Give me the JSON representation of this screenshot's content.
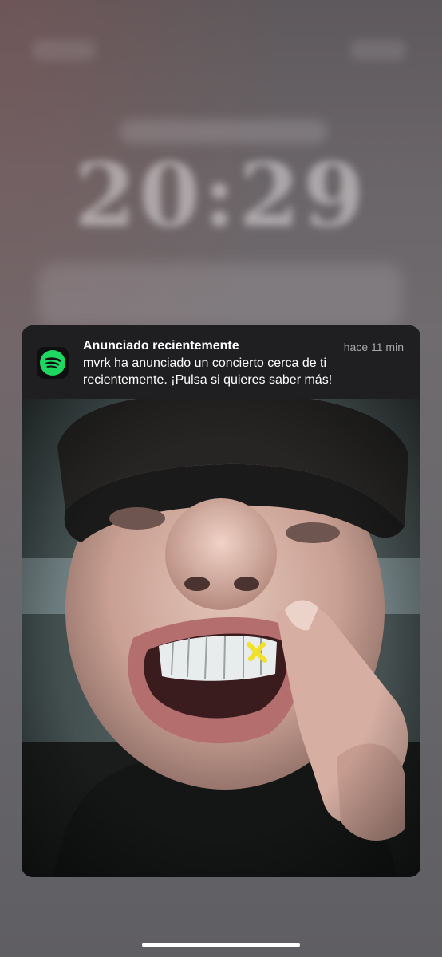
{
  "lock_screen": {
    "clock": "20:29"
  },
  "notification": {
    "app_icon": "spotify-icon",
    "title": "Anunciado recientemente",
    "time": "hace 11 min",
    "body": "mvrk ha anunciado un concierto cerca de ti recientemente. ¡Pulsa si quieres saber más!",
    "image": "artist-photo"
  },
  "colors": {
    "spotify_green": "#1ed760",
    "notification_bg": "#1f1f21",
    "grill_accent": "#f2e12a"
  }
}
